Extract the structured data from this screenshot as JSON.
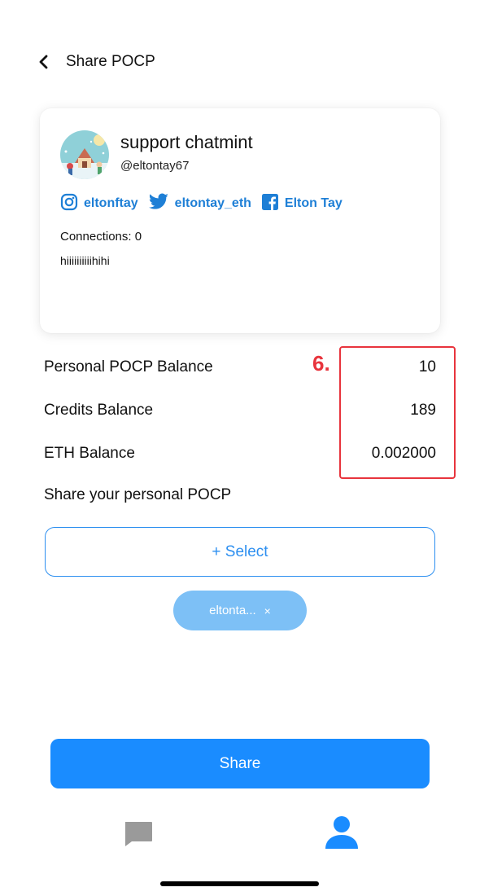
{
  "header": {
    "title": "Share POCP"
  },
  "profile": {
    "name": "support chatmint",
    "handle": "@eltontay67",
    "socials": [
      {
        "icon": "instagram-icon",
        "label": "eltonftay"
      },
      {
        "icon": "twitter-icon",
        "label": "eltontay_eth"
      },
      {
        "icon": "facebook-icon",
        "label": "Elton Tay"
      }
    ],
    "connections": "Connections: 0",
    "bio": "hiiiiiiiiiihihi"
  },
  "balances": [
    {
      "label": "Personal POCP Balance",
      "value": "10"
    },
    {
      "label": "Credits Balance",
      "value": "189"
    },
    {
      "label": "ETH Balance",
      "value": "0.002000"
    }
  ],
  "annotation": {
    "number": "6."
  },
  "share_section": {
    "title": "Share your personal POCP",
    "select_label": "+ Select",
    "chip_label": "eltonta...",
    "chip_remove": "×"
  },
  "share_button": {
    "label": "Share"
  },
  "tabbar": {
    "items": [
      "chat-icon",
      "profile-icon"
    ]
  },
  "colors": {
    "accent": "#1a8cff",
    "link": "#1e7fd6",
    "chip": "#7dc0f6",
    "annotation": "#e8343d"
  }
}
